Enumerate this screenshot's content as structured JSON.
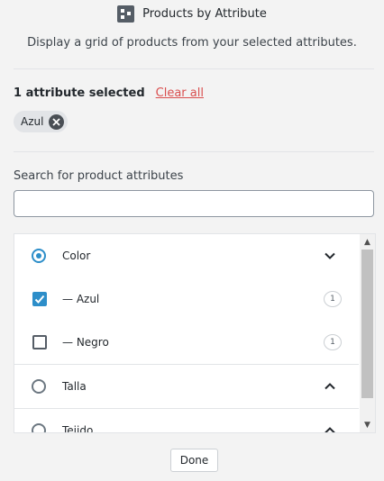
{
  "header": {
    "icon": "products-by-attribute-block-icon",
    "title": "Products by Attribute"
  },
  "description": "Display a grid of products from your selected attributes.",
  "selection": {
    "count_text": "1 attribute selected",
    "clear_all_label": "Clear all",
    "chips": [
      {
        "label": "Azul",
        "remove_icon": "remove-circle-icon"
      }
    ]
  },
  "search": {
    "label": "Search for product attributes",
    "value": "",
    "placeholder": ""
  },
  "attributes": [
    {
      "type": "parent",
      "label": "Color",
      "selected": true,
      "expanded": true
    },
    {
      "type": "child",
      "label": "— Azul",
      "checked": true,
      "count": "1"
    },
    {
      "type": "child",
      "label": "— Negro",
      "checked": false,
      "count": "1"
    },
    {
      "type": "parent",
      "label": "Talla",
      "selected": false,
      "expanded": true
    },
    {
      "type": "parent",
      "label": "Tejido",
      "selected": false,
      "expanded": true
    }
  ],
  "colors": {
    "accent": "#2d8ec9",
    "danger": "#d94f4f",
    "background": "#f3f3f3"
  },
  "done_label": "Done"
}
